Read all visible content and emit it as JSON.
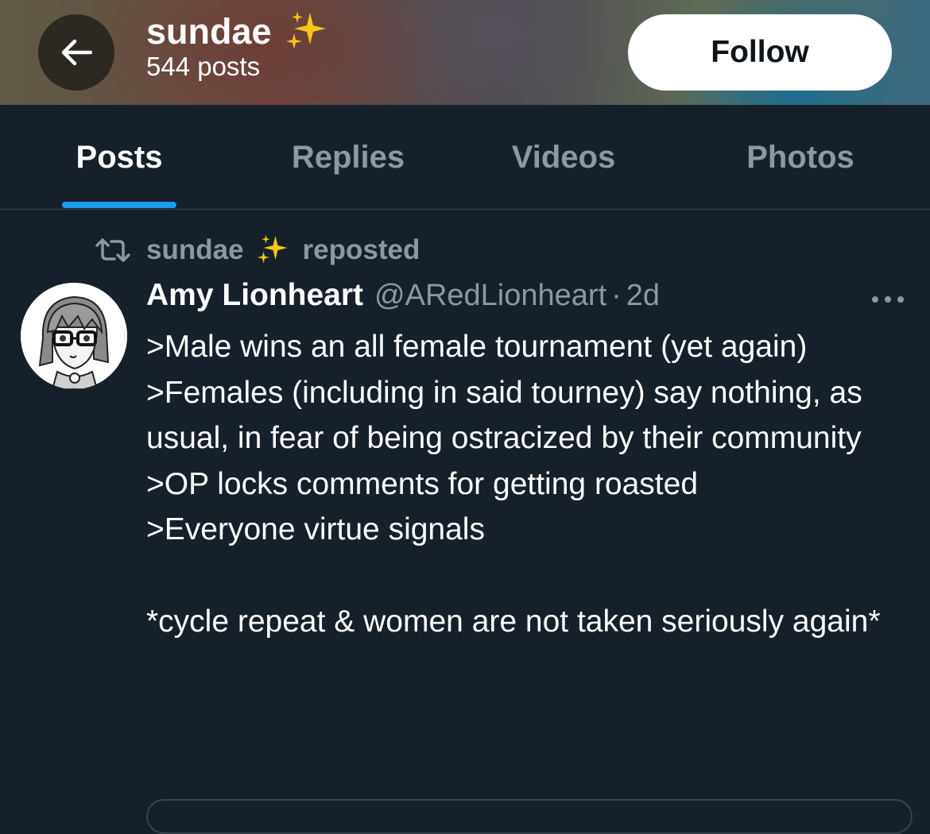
{
  "header": {
    "title": "sundae",
    "title_emoji": "✨",
    "subtitle": "544 posts",
    "follow_label": "Follow",
    "back_icon": "arrow-left-icon"
  },
  "tabs": [
    {
      "label": "Posts",
      "active": true
    },
    {
      "label": "Replies",
      "active": false
    },
    {
      "label": "Videos",
      "active": false
    },
    {
      "label": "Photos",
      "active": false
    }
  ],
  "tweet": {
    "repost": {
      "user": "sundae",
      "emoji": "✨",
      "label": "reposted",
      "icon": "repost-icon"
    },
    "author_name": "Amy Lionheart",
    "handle": "@ARedLionheart",
    "separator": "·",
    "time": "2d",
    "more_icon": "more-icon",
    "text": ">Male wins an all female tournament (yet again)\n>Females (including in said tourney) say nothing, as usual, in fear of being ostracized by their community\n>OP locks comments for getting roasted\n>Everyone virtue signals\n\n*cycle repeat & women are not taken seriously again*"
  },
  "colors": {
    "background": "#15202b",
    "accent": "#1d9bf0",
    "muted": "#8b98a5",
    "divider": "#38444d",
    "sparkle": "#f5c518"
  }
}
